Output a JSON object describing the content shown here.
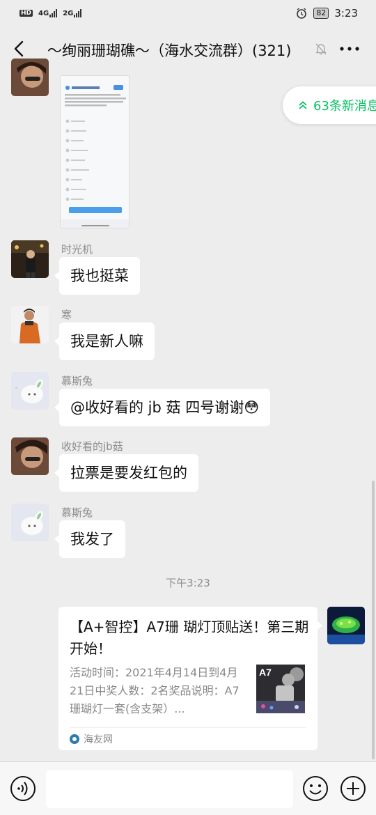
{
  "status_bar": {
    "hd": "HD",
    "net1": "4G",
    "net2": "2G",
    "battery": "82",
    "time": "3:23"
  },
  "header": {
    "title": "～绚丽珊瑚礁～（海水交流群）(321)",
    "icons": [
      "back-arrow-icon",
      "bell-muted-icon",
      "more-dots-icon"
    ]
  },
  "new_messages": {
    "label": "63条新消息",
    "icon": "double-chevron-up-icon",
    "color": "#07c160"
  },
  "messages": [
    {
      "sender": "时光机",
      "text": "我也挺菜"
    },
    {
      "sender": "寒",
      "text": "我是新人嘛"
    },
    {
      "sender": "慕斯兔",
      "text": "@收好看的 jb 菇  四号谢谢😳"
    },
    {
      "sender": "收好看的jb菇",
      "text": "拉票是要发红包的"
    },
    {
      "sender": "慕斯兔",
      "text": "我发了"
    }
  ],
  "timestamp": "下午3:23",
  "link_card": {
    "title": "【A+智控】A7珊 瑚灯顶贴送！第三期开始！",
    "description": "活动时间：2021年4月14日到4月21日中奖人数：2名奖品说明：A7珊瑚灯一套(含支架）...",
    "thumb_label": "A7",
    "source": "海友网"
  },
  "input_bar": {
    "placeholder": "",
    "icons": [
      "voice-icon",
      "emoji-icon",
      "plus-icon"
    ]
  },
  "colors": {
    "background": "#ededed",
    "accent": "#07c160",
    "bubble": "#ffffff"
  }
}
